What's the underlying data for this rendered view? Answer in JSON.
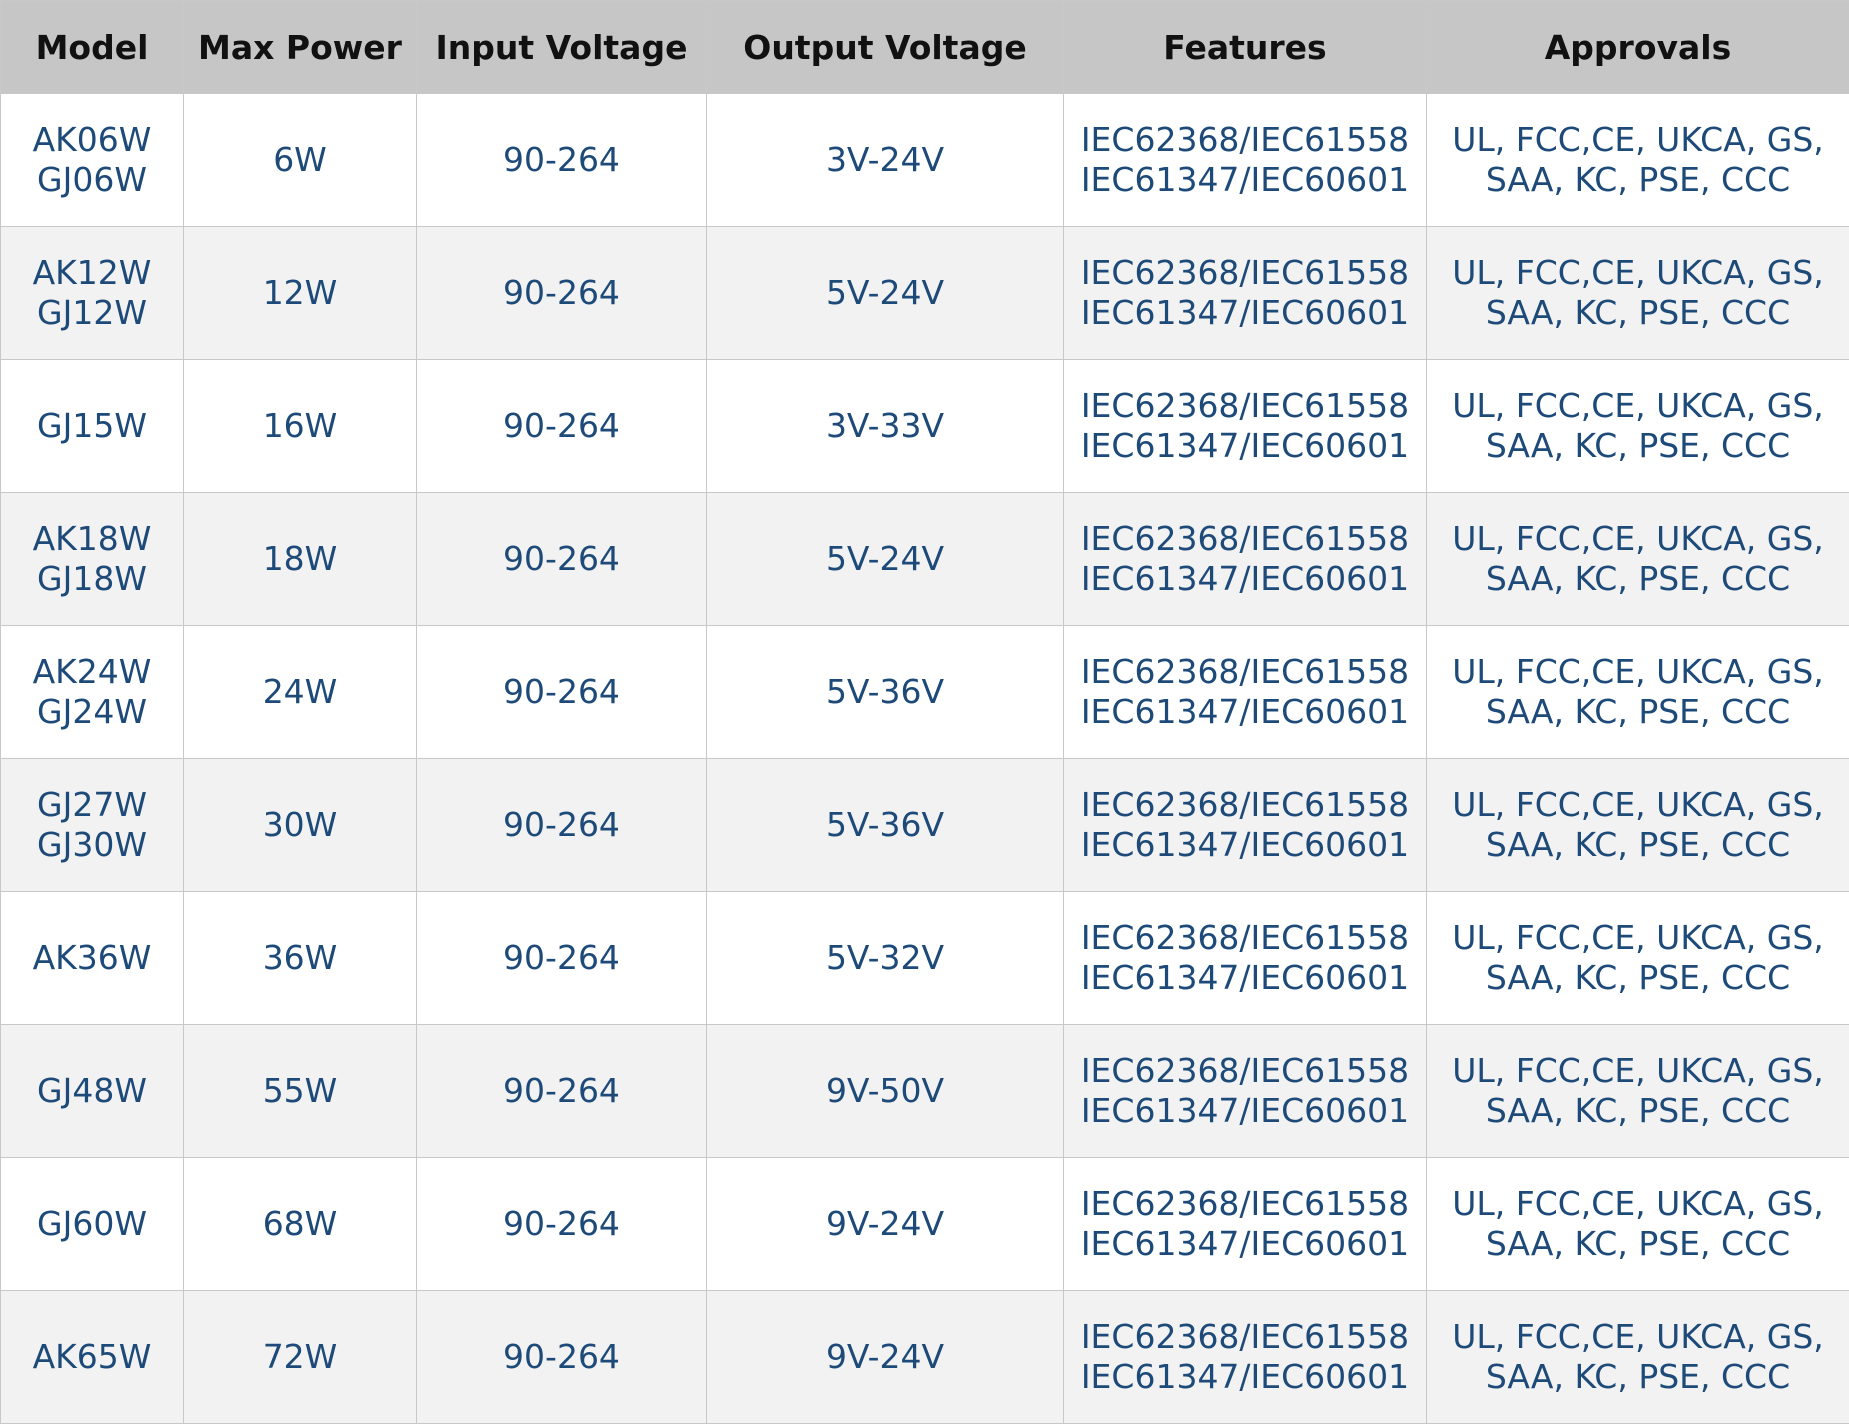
{
  "table": {
    "headers": [
      "Model",
      "Max Power",
      "Input Voltage",
      "Output Voltage",
      "Features",
      "Approvals"
    ],
    "rows": [
      {
        "model": [
          "AK06W",
          "GJ06W"
        ],
        "max_power": "6W",
        "input_voltage": "90-264",
        "output_voltage": "3V-24V",
        "features": [
          "IEC62368/IEC61558",
          "IEC61347/IEC60601"
        ],
        "approvals": [
          "UL, FCC,CE, UKCA, GS,",
          "SAA, KC, PSE, CCC"
        ]
      },
      {
        "model": [
          "AK12W",
          "GJ12W"
        ],
        "max_power": "12W",
        "input_voltage": "90-264",
        "output_voltage": "5V-24V",
        "features": [
          "IEC62368/IEC61558",
          "IEC61347/IEC60601"
        ],
        "approvals": [
          "UL, FCC,CE, UKCA, GS,",
          "SAA, KC, PSE, CCC"
        ]
      },
      {
        "model": [
          "GJ15W"
        ],
        "max_power": "16W",
        "input_voltage": "90-264",
        "output_voltage": "3V-33V",
        "features": [
          "IEC62368/IEC61558",
          "IEC61347/IEC60601"
        ],
        "approvals": [
          "UL, FCC,CE, UKCA, GS,",
          "SAA, KC, PSE, CCC"
        ]
      },
      {
        "model": [
          "AK18W",
          "GJ18W"
        ],
        "max_power": "18W",
        "input_voltage": "90-264",
        "output_voltage": "5V-24V",
        "features": [
          "IEC62368/IEC61558",
          "IEC61347/IEC60601"
        ],
        "approvals": [
          "UL, FCC,CE, UKCA, GS,",
          "SAA, KC, PSE, CCC"
        ]
      },
      {
        "model": [
          "AK24W",
          "GJ24W"
        ],
        "max_power": "24W",
        "input_voltage": "90-264",
        "output_voltage": "5V-36V",
        "features": [
          "IEC62368/IEC61558",
          "IEC61347/IEC60601"
        ],
        "approvals": [
          "UL, FCC,CE, UKCA, GS,",
          "SAA, KC, PSE, CCC"
        ]
      },
      {
        "model": [
          "GJ27W",
          "GJ30W"
        ],
        "max_power": "30W",
        "input_voltage": "90-264",
        "output_voltage": "5V-36V",
        "features": [
          "IEC62368/IEC61558",
          "IEC61347/IEC60601"
        ],
        "approvals": [
          "UL, FCC,CE, UKCA, GS,",
          "SAA, KC, PSE, CCC"
        ]
      },
      {
        "model": [
          "AK36W"
        ],
        "max_power": "36W",
        "input_voltage": "90-264",
        "output_voltage": "5V-32V",
        "features": [
          "IEC62368/IEC61558",
          "IEC61347/IEC60601"
        ],
        "approvals": [
          "UL, FCC,CE, UKCA, GS,",
          "SAA, KC, PSE, CCC"
        ]
      },
      {
        "model": [
          "GJ48W"
        ],
        "max_power": "55W",
        "input_voltage": "90-264",
        "output_voltage": "9V-50V",
        "features": [
          "IEC62368/IEC61558",
          "IEC61347/IEC60601"
        ],
        "approvals": [
          "UL, FCC,CE, UKCA, GS,",
          "SAA, KC, PSE, CCC"
        ]
      },
      {
        "model": [
          "GJ60W"
        ],
        "max_power": "68W",
        "input_voltage": "90-264",
        "output_voltage": "9V-24V",
        "features": [
          "IEC62368/IEC61558",
          "IEC61347/IEC60601"
        ],
        "approvals": [
          "UL, FCC,CE, UKCA, GS,",
          "SAA, KC, PSE, CCC"
        ]
      },
      {
        "model": [
          "AK65W"
        ],
        "max_power": "72W",
        "input_voltage": "90-264",
        "output_voltage": "9V-24V",
        "features": [
          "IEC62368/IEC61558",
          "IEC61347/IEC60601"
        ],
        "approvals": [
          "UL, FCC,CE, UKCA, GS,",
          "SAA, KC, PSE, CCC"
        ]
      }
    ]
  },
  "colors": {
    "header_bg": "#c6c6c6",
    "header_text": "#111111",
    "cell_text": "#1d4a78",
    "row_alt_bg": "#f2f2f2",
    "border": "#c8c8c8"
  }
}
